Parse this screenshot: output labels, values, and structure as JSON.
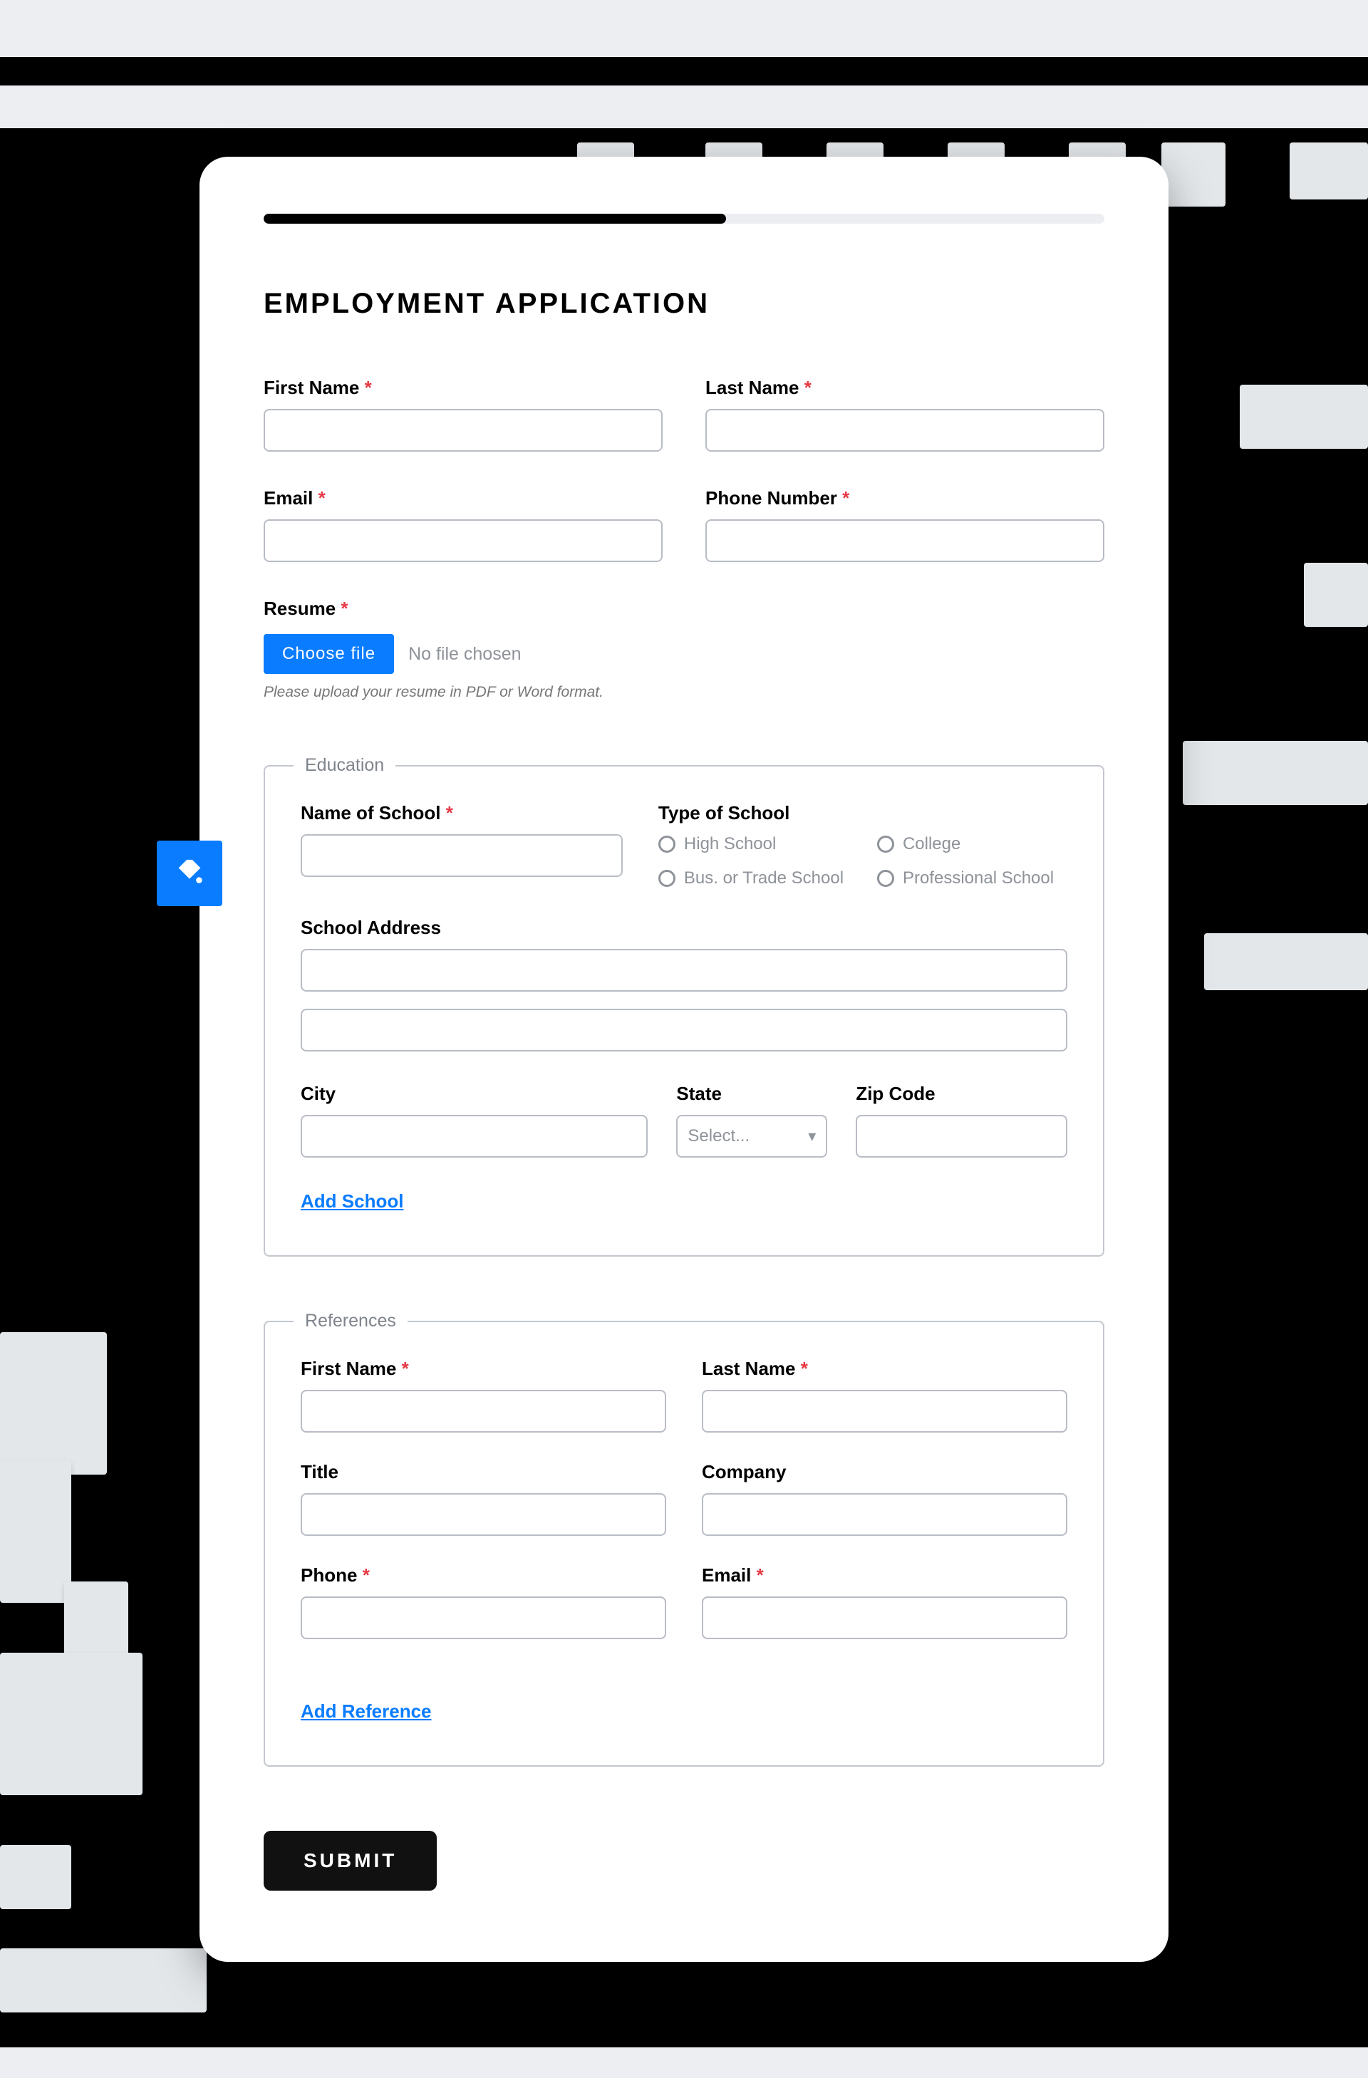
{
  "form": {
    "title": "EMPLOYMENT APPLICATION",
    "first_name_label": "First Name",
    "last_name_label": "Last Name",
    "email_label": "Email",
    "phone_label": "Phone Number",
    "resume_label": "Resume",
    "choose_file_label": "Choose file",
    "no_file_label": "No file chosen",
    "resume_note": "Please upload your resume in PDF or Word format.",
    "submit_label": "SUBMIT"
  },
  "education": {
    "legend": "Education",
    "school_name_label": "Name of School",
    "school_type_label": "Type of School",
    "type_options": [
      "High School",
      "College",
      "Bus. or Trade School",
      "Professional School"
    ],
    "address_label": "School Address",
    "city_label": "City",
    "state_label": "State",
    "state_placeholder": "Select...",
    "zip_label": "Zip Code",
    "add_label": "Add School"
  },
  "references": {
    "legend": "References",
    "first_name_label": "First Name",
    "last_name_label": "Last Name",
    "title_label": "Title",
    "company_label": "Company",
    "phone_label": "Phone",
    "email_label": "Email",
    "add_label": "Add Reference"
  }
}
